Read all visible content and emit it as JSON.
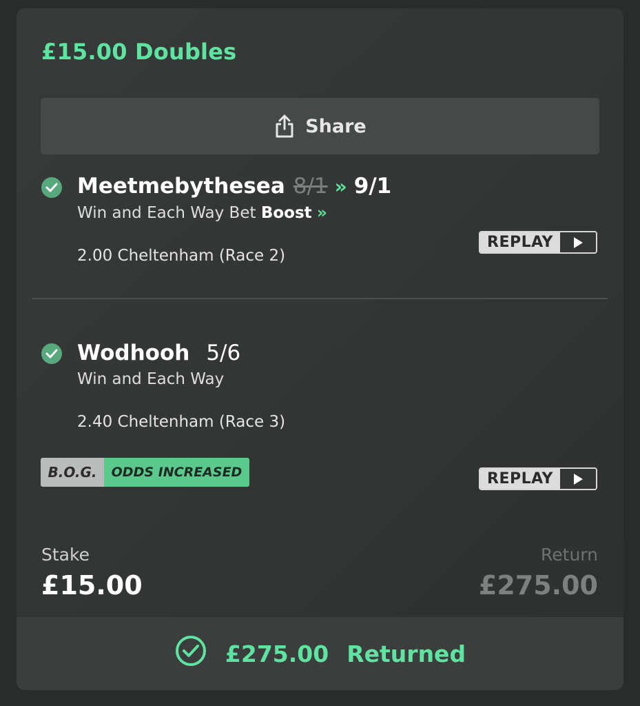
{
  "bet": {
    "title": "£15.00 Doubles",
    "share_label": "Share"
  },
  "selections": [
    {
      "name": "Meetmebythesea",
      "old_odds": "8/1",
      "boost_arrow": "»",
      "odds": "9/1",
      "market_prefix": "Win and Each Way  Bet ",
      "market_boost": "Boost",
      "market_arrow": "»",
      "race": "2.00 Cheltenham (Race 2)",
      "replay_label": "REPLAY"
    },
    {
      "name": "Wodhooh",
      "odds": "5/6",
      "market": "Win and Each Way",
      "race": "2.40 Cheltenham (Race 3)",
      "replay_label": "REPLAY",
      "badge_left": "B.O.G.",
      "badge_right": "ODDS INCREASED"
    }
  ],
  "summary": {
    "stake_label": "Stake",
    "stake_value": "£15.00",
    "return_label": "Return",
    "return_value": "£275.00"
  },
  "result": {
    "amount": "£275.00",
    "status": "Returned"
  },
  "colors": {
    "accent_green": "#5fe3a1",
    "check_green": "#57a87c",
    "card_bg": "#343735"
  }
}
